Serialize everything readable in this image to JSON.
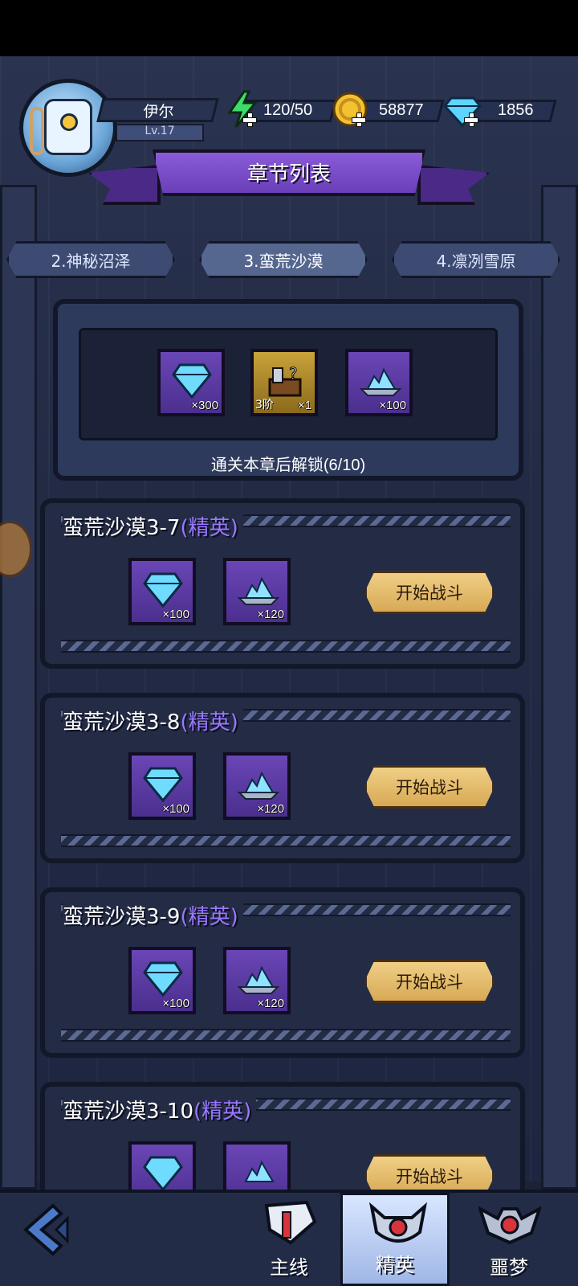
{
  "player": {
    "name": "伊尔",
    "level": "Lv.17"
  },
  "resources": [
    {
      "key": "energy",
      "value": "120/50",
      "icon": "lightning-icon",
      "color": "#3ddc6a"
    },
    {
      "key": "gold",
      "value": "58877",
      "icon": "coin-icon",
      "color": "#f2c232"
    },
    {
      "key": "gem",
      "value": "1856",
      "icon": "diamond-icon",
      "color": "#5ed4ff"
    }
  ],
  "title": "章节列表",
  "chapters": [
    {
      "label": "2.神秘沼泽",
      "active": false
    },
    {
      "label": "3.蛮荒沙漠",
      "active": true
    },
    {
      "label": "4.凛冽雪原",
      "active": false
    }
  ],
  "chapter_rewards": {
    "items": [
      {
        "icon": "diamond-icon",
        "qty": "×300"
      },
      {
        "icon": "mystery-chest-icon",
        "tier": "3阶",
        "qty": "×1"
      },
      {
        "icon": "crystal-shards-icon",
        "qty": "×100"
      }
    ],
    "unlock_text": "通关本章后解锁(6/10)"
  },
  "stages": [
    {
      "name": "蛮荒沙漠3-7",
      "tag": "(精英)",
      "rewards": [
        "×100",
        "×120"
      ],
      "button": "开始战斗"
    },
    {
      "name": "蛮荒沙漠3-8",
      "tag": "(精英)",
      "rewards": [
        "×100",
        "×120"
      ],
      "button": "开始战斗"
    },
    {
      "name": "蛮荒沙漠3-9",
      "tag": "(精英)",
      "rewards": [
        "×100",
        "×120"
      ],
      "button": "开始战斗"
    },
    {
      "name": "蛮荒沙漠3-10",
      "tag": "(精英)",
      "rewards": [
        "",
        ""
      ],
      "button": "开始战斗"
    }
  ],
  "nav": [
    {
      "label": "主线",
      "icon": "mainline-icon",
      "active": false
    },
    {
      "label": "精英",
      "icon": "elite-demon-icon",
      "active": true
    },
    {
      "label": "噩梦",
      "icon": "nightmare-bat-icon",
      "active": false
    }
  ],
  "colors": {
    "accent_purple": "#9a78ff",
    "button_gold": "#e6bd6e",
    "panel": "#2e3a5c"
  }
}
